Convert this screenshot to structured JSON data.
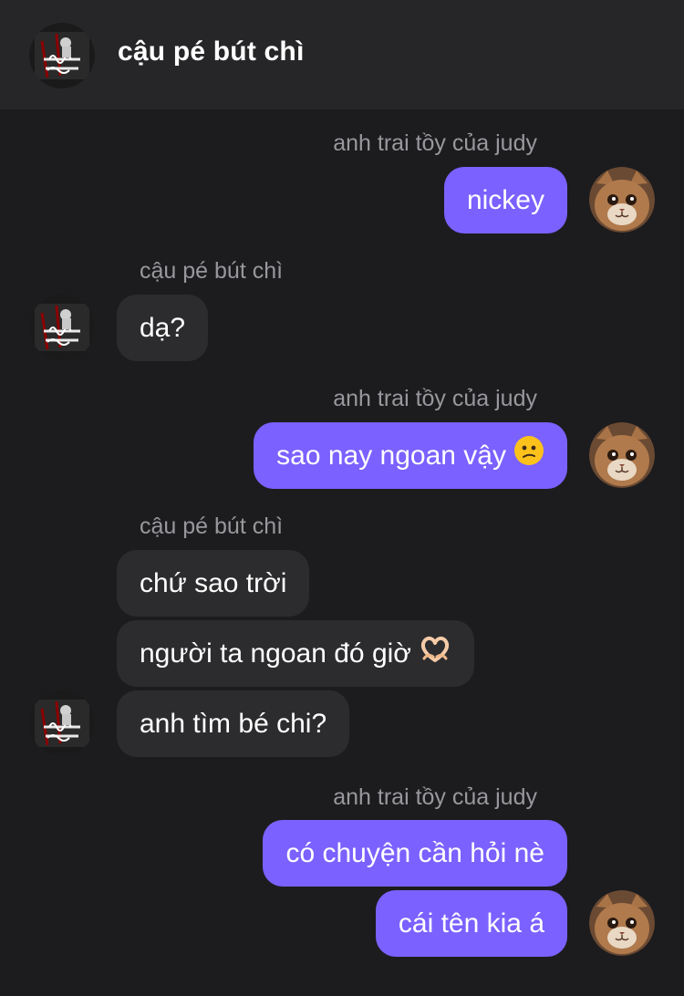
{
  "header": {
    "title": "cậu pé bút chì",
    "avatar_icon": "graffiti-avatar-icon"
  },
  "colors": {
    "background": "#1c1c1e",
    "header": "#262628",
    "outgoing_bubble": "#7b61ff",
    "incoming_bubble": "#2c2c2e",
    "sender_name": "#98989d"
  },
  "messages": {
    "g1": {
      "sender": "anh trai tồy của judy",
      "m1": "nickey"
    },
    "g2": {
      "sender": "cậu pé bút chì",
      "m1": "dạ?"
    },
    "g3": {
      "sender": "anh trai tồy của judy",
      "m1": "sao nay ngoan vậy",
      "m1_emoji": "confused-face-emoji"
    },
    "g4": {
      "sender": "cậu pé bút chì",
      "m1": "chứ sao trời",
      "m2": "người ta ngoan đó giờ",
      "m2_emoji": "heart-hands-emoji",
      "m3": "anh tìm bé chi?"
    },
    "g5": {
      "sender": "anh trai tồy của judy",
      "m1": "có chuyện cần hỏi nè",
      "m2": "cái tên kia á"
    }
  }
}
